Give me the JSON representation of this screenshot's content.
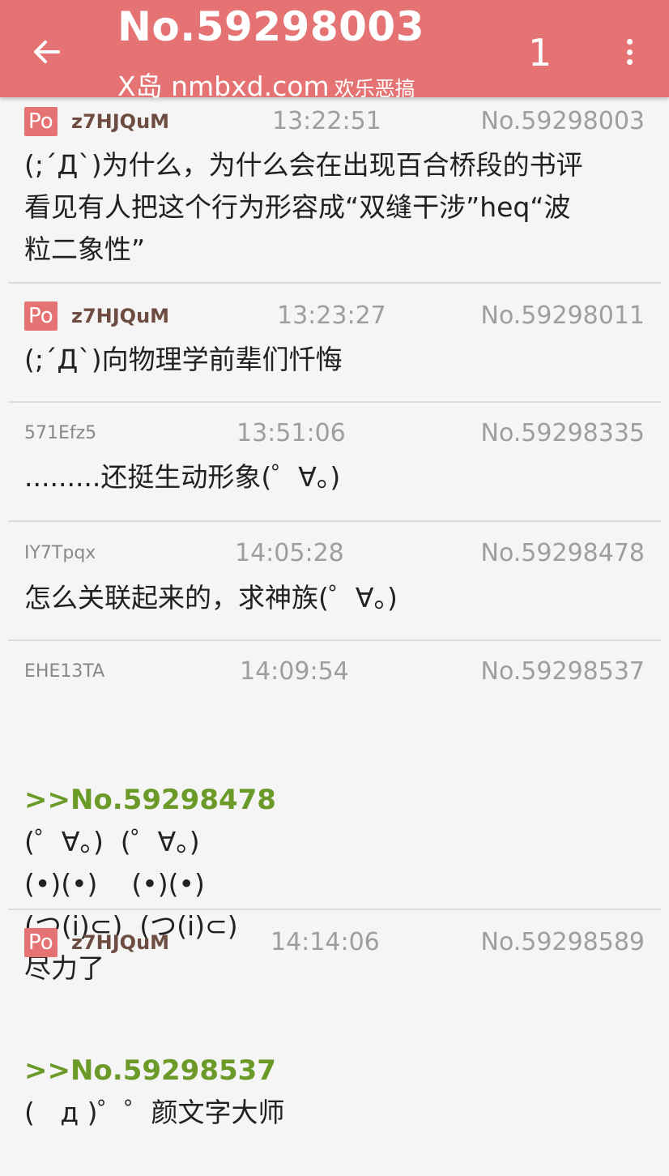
{
  "header": {
    "title": "No.59298003",
    "site": "X岛 nmbxd.com",
    "tag": "欢乐恶搞",
    "page": "1"
  },
  "posts": [
    {
      "po": "Po",
      "user": "z7HJQuM",
      "time": "13:22:51",
      "no": "No.59298003",
      "text": "(;´Д`)为什么，为什么会在出现百合桥段的书评\n看见有人把这个行为形容成“双缝干涉”heq“波\n粒二象性”"
    },
    {
      "po": "Po",
      "user": "z7HJQuM",
      "time": "13:23:27",
      "no": "No.59298011",
      "text": "(;´Д`)向物理学前辈们忏悔"
    },
    {
      "user": "571Efz5",
      "time": "13:51:06",
      "no": "No.59298335",
      "text": ".........还挺生动形象(゜∀。)"
    },
    {
      "user": "IY7Tpqx",
      "time": "14:05:28",
      "no": "No.59298478",
      "text": "怎么关联起来的，求神族(゜∀。)"
    },
    {
      "user": "EHE13TA",
      "time": "14:09:54",
      "no": "No.59298537",
      "quote": ">>No.59298478",
      "text": "(゜∀。)  (゜∀。)\n(•)(•)    (•)(•)\n(つ(i)⊂)  (つ(i)⊂)\n尽力了"
    },
    {
      "po": "Po",
      "user": "z7HJQuM",
      "time": "14:14:06",
      "no": "No.59298589",
      "quote": ">>No.59298537",
      "text": "(   д )゜゜颜文字大师"
    }
  ]
}
